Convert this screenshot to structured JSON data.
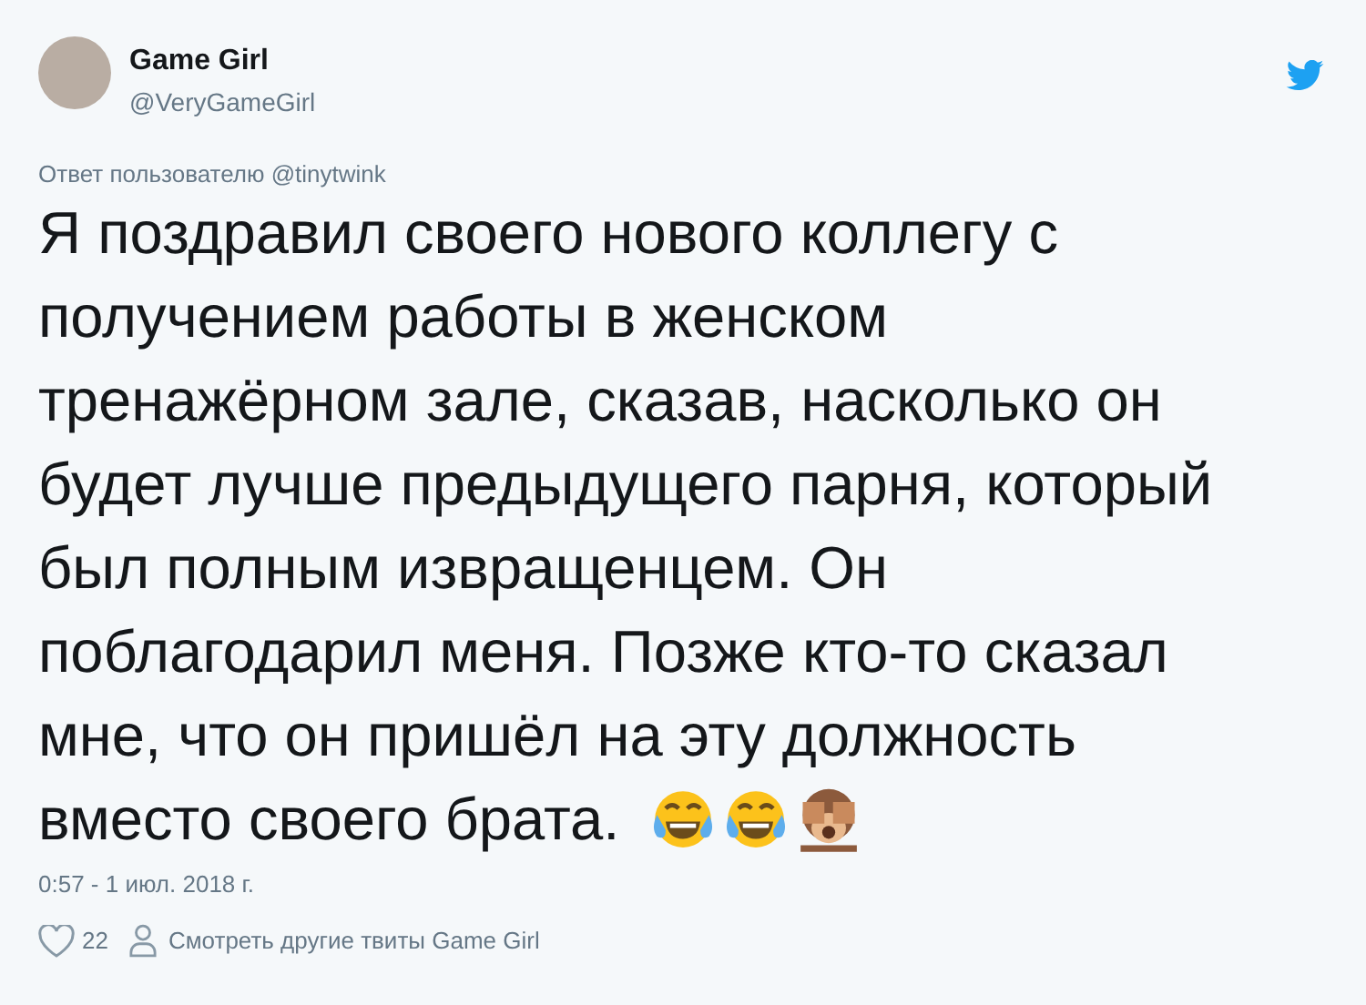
{
  "author": {
    "name": "Game Girl",
    "handle": "@VeryGameGirl"
  },
  "reply_to": "Ответ пользователю @tinytwink",
  "text_lines": [
    "Я поздравил своего нового коллегу с",
    "получением работы в женском",
    "тренажёрном зале, сказав, насколько он",
    "будет лучше предыдущего парня, который",
    "был полным извращенцем. Он",
    "поблагодарил меня. Позже кто-то сказал",
    "мне, что он пришёл на эту должность",
    "вместо своего брата."
  ],
  "emojis": [
    {
      "kind": "tears-of-joy"
    },
    {
      "kind": "tears-of-joy"
    },
    {
      "kind": "see-no-evil-monkey"
    }
  ],
  "timestamp": "0:57 - 1 июл. 2018 г.",
  "likes": "22",
  "more_link": "Смотреть другие твиты Game Girl"
}
